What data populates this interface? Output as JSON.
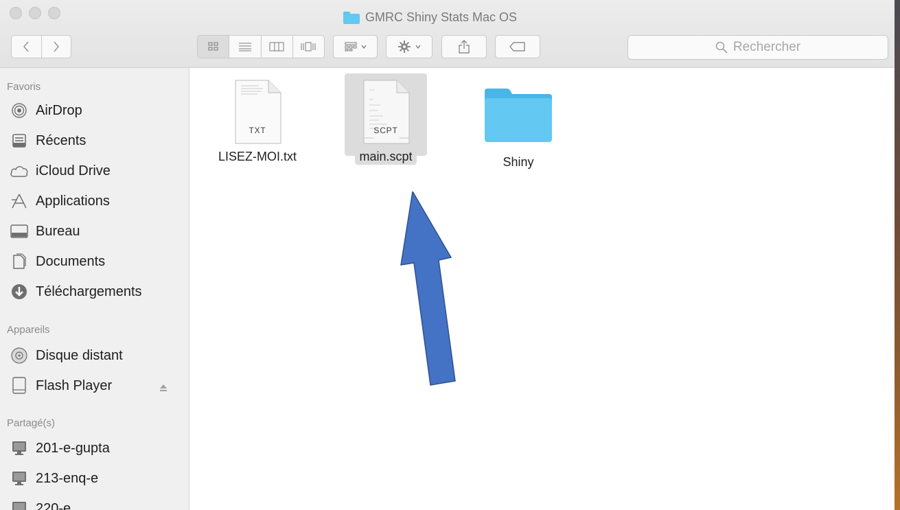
{
  "window": {
    "title": "GMRC Shiny Stats Mac OS"
  },
  "toolbar": {
    "search_placeholder": "Rechercher"
  },
  "sidebar": {
    "sections": [
      {
        "title": "Favoris"
      },
      {
        "title": "Appareils"
      },
      {
        "title": "Partagé(s)"
      }
    ],
    "favoris": [
      {
        "label": "AirDrop",
        "icon": "airdrop-icon"
      },
      {
        "label": "Récents",
        "icon": "recents-icon"
      },
      {
        "label": "iCloud Drive",
        "icon": "cloud-icon"
      },
      {
        "label": "Applications",
        "icon": "applications-icon"
      },
      {
        "label": "Bureau",
        "icon": "desktop-icon"
      },
      {
        "label": "Documents",
        "icon": "documents-icon"
      },
      {
        "label": "Téléchargements",
        "icon": "downloads-icon"
      }
    ],
    "appareils": [
      {
        "label": "Disque distant",
        "icon": "disc-icon"
      },
      {
        "label": "Flash Player",
        "icon": "drive-icon"
      }
    ],
    "partages": [
      {
        "label": "201-e-gupta",
        "icon": "computer-icon"
      },
      {
        "label": "213-enq-e",
        "icon": "computer-icon"
      },
      {
        "label": "220-e",
        "icon": "computer-icon"
      }
    ]
  },
  "files": [
    {
      "name": "LISEZ-MOI.txt",
      "kind": "TXT",
      "selected": false
    },
    {
      "name": "main.scpt",
      "kind": "SCPT",
      "selected": true
    },
    {
      "name": "Shiny",
      "kind": "folder",
      "selected": false
    }
  ],
  "colors": {
    "folder": "#63c8f2",
    "arrow": "#4472c4",
    "selection": "#dcdcdc"
  }
}
